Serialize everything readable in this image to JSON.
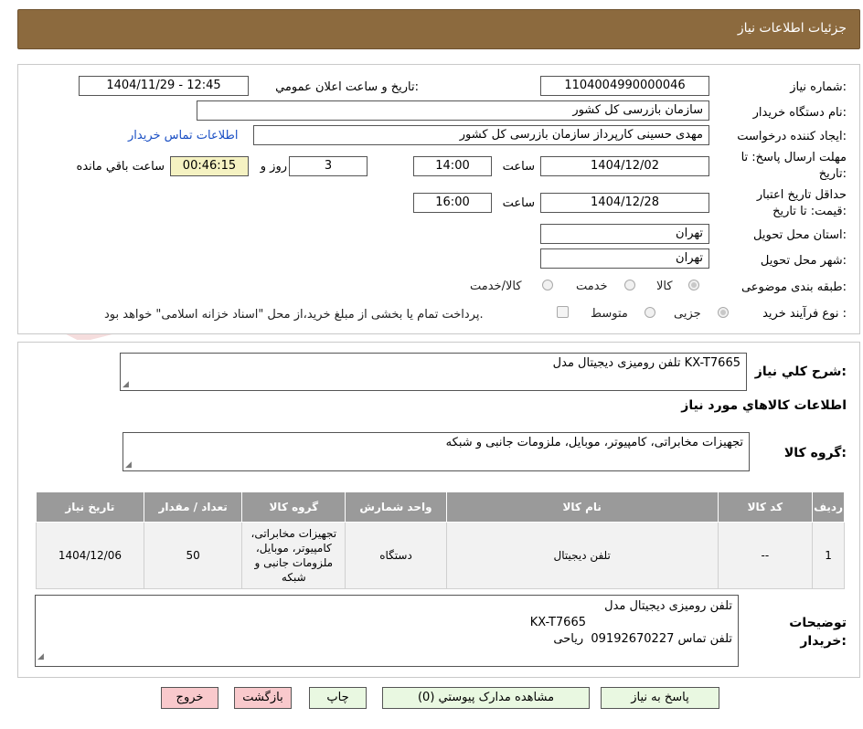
{
  "header": {
    "title": "جزئیات اطلاعات نیاز"
  },
  "watermark": {
    "text": "AriaTender.neT"
  },
  "fields": {
    "need_number": {
      "label": "شماره نیاز:",
      "value": "1104004990000046"
    },
    "announce": {
      "label": "تاریخ و ساعت اعلان عمومي:",
      "value": "1404/11/29 - 12:45"
    },
    "buyer_org": {
      "label": "نام دستگاه خریدار:",
      "value": "سازمان بازرسی کل کشور"
    },
    "requester": {
      "label": "ایجاد کننده درخواست:",
      "value": "مهدی حسینی کارپرداز سازمان بازرسی کل کشور",
      "contact_link": "اطلاعات تماس خریدار"
    },
    "reply_deadline": {
      "label": "مهلت ارسال پاسخ: تا تاریخ:",
      "date": "1404/12/02",
      "time_label": "ساعت",
      "time": "14:00",
      "days": "3",
      "days_label": "روز و",
      "remaining": "00:46:15",
      "remaining_label": "ساعت باقي مانده"
    },
    "price_validity": {
      "label": "حداقل تاریخ اعتبار قیمت: تا تاریخ:",
      "date": "1404/12/28",
      "time_label": "ساعت",
      "time": "16:00"
    },
    "province": {
      "label": "استان محل تحویل:",
      "value": "تهران"
    },
    "city": {
      "label": "شهر محل تحویل:",
      "value": "تهران"
    },
    "category": {
      "label": "طبقه بندی موضوعی:",
      "options": [
        "کالا",
        "خدمت",
        "کالا/خدمت"
      ]
    },
    "process": {
      "label": "نوع فرآیند خرید :",
      "options": [
        "جزیی",
        "متوسط"
      ],
      "note": "پرداخت تمام یا بخشی از مبلغ خرید،از محل \"اسناد خزانه اسلامی\" خواهد بود."
    }
  },
  "summary": {
    "label": "شرح کلي نیاز:",
    "value": "تلفن رومیزی دیجیتال مدل KX-T7665"
  },
  "goods_info": {
    "title": "اطلاعات کالاهاي مورد نیاز",
    "group_label": "گروه کالا:",
    "group_value": "تجهیزات مخابراتی، کامپیوتر، موبایل، ملزومات جانبی و شبکه"
  },
  "table": {
    "headers": [
      "ردیف",
      "کد کالا",
      "نام کالا",
      "واحد شمارش",
      "گروه کالا",
      "تعداد / مقدار",
      "تاریخ نیاز"
    ],
    "rows": [
      {
        "row": "1",
        "code": "--",
        "name": "تلفن دیجیتال",
        "unit": "دستگاه",
        "group": "تجهیزات مخابراتی، کامپیوتر، موبایل، ملزومات جانبی و شبکه",
        "qty": "50",
        "date": "1404/12/06"
      }
    ]
  },
  "buyer_notes": {
    "label": "توضیحات خریدار:",
    "lines": [
      "تلفن رومیزی دیجیتال مدل",
      "KX-T7665",
      "تلفن تماس 09192670227  ریاحی"
    ]
  },
  "buttons": {
    "reply": "پاسخ به نیاز",
    "attachments": "مشاهده مدارک پیوستي (0)",
    "print": "چاپ",
    "back": "بازگشت",
    "exit": "خروج"
  },
  "colors": {
    "header": "#8c6a3e",
    "button_green": "#e9f8e1",
    "button_pink": "#f9c9cc",
    "link": "#1a4fc4",
    "table_header": "#9a9a9a"
  }
}
